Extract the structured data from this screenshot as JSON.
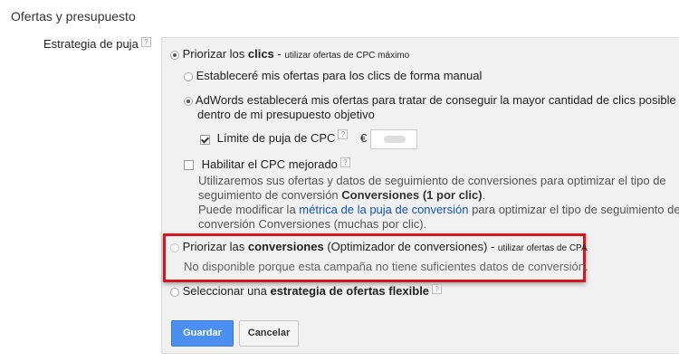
{
  "section_title": "Ofertas y presupuesto",
  "field_label": "Estrategia de puja",
  "help_glyph": "?",
  "clicks": {
    "label_prefix": "Priorizar los ",
    "label_bold": "clics",
    "label_suffix": " - ",
    "small_note": "utilizar ofertas de CPC máximo",
    "manual_option": "Estableceré mis ofertas para los clics de forma manual",
    "auto_option_line1": "AdWords establecerá mis ofertas para tratar de conseguir la mayor cantidad de clics posible",
    "auto_option_line2": "dentro de mi presupuesto objetivo",
    "cpc_limit_label": "Límite de puja de CPC",
    "currency": "€",
    "enhanced_cpc_label": "Habilitar el CPC mejorado",
    "desc_line1": "Utilizaremos sus ofertas y datos de seguimiento de conversiones para optimizar el tipo de",
    "desc_line2_prefix": "seguimiento de conversión ",
    "desc_line2_bold": "Conversiones (1 por clic)",
    "desc_line2_suffix": ".",
    "desc_line3_prefix": "Puede modificar la ",
    "desc_line3_link": "métrica de la puja de conversión",
    "desc_line3_suffix": " para optimizar el tipo de seguimiento de",
    "desc_line4": "conversión Conversiones (muchas por clic)."
  },
  "conversions": {
    "label_prefix": "Priorizar las ",
    "label_bold": "conversiones",
    "label_suffix": " (Optimizador de conversiones) - ",
    "small_note": "utilizar ofertas de CPA",
    "unavailable": "No disponible porque esta campaña no tiene suficientes datos de conversión."
  },
  "flexible": {
    "label_prefix": "Seleccionar una ",
    "label_bold": "estrategia de ofertas flexible"
  },
  "buttons": {
    "save": "Guardar",
    "cancel": "Cancelar"
  },
  "colors": {
    "highlight": "#d0181e",
    "primary": "#4b8ff3",
    "link": "#1155cc"
  }
}
